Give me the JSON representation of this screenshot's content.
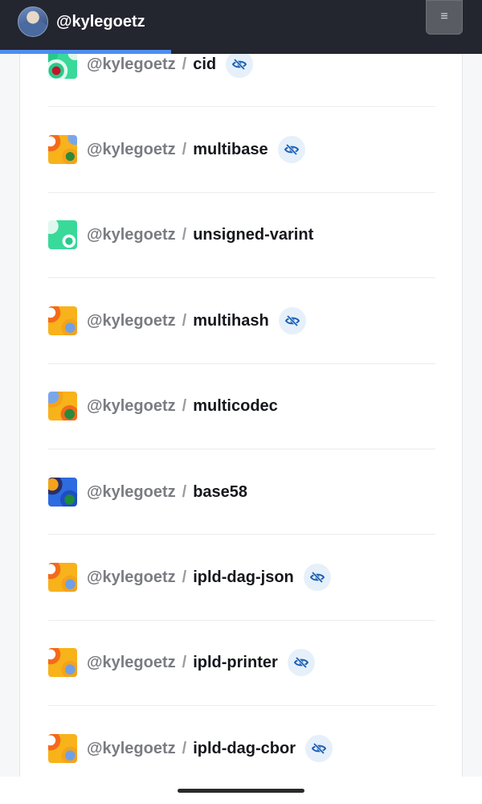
{
  "header": {
    "username": "@kylegoetz",
    "menu_icon": "hamburger-icon",
    "menu_glyph": "≡",
    "avatar_icon": "user-avatar"
  },
  "loading_progress": 0.355,
  "repos": [
    {
      "owner": "@kylegoetz",
      "separator": "/",
      "name": "cid",
      "private": true,
      "icon_style": "green"
    },
    {
      "owner": "@kylegoetz",
      "separator": "/",
      "name": "multibase",
      "private": true,
      "icon_style": "orange"
    },
    {
      "owner": "@kylegoetz",
      "separator": "/",
      "name": "unsigned-varint",
      "private": false,
      "icon_style": "green2"
    },
    {
      "owner": "@kylegoetz",
      "separator": "/",
      "name": "multihash",
      "private": true,
      "icon_style": "orange-blue"
    },
    {
      "owner": "@kylegoetz",
      "separator": "/",
      "name": "multicodec",
      "private": false,
      "icon_style": "orange-green"
    },
    {
      "owner": "@kylegoetz",
      "separator": "/",
      "name": "base58",
      "private": false,
      "icon_style": "blue"
    },
    {
      "owner": "@kylegoetz",
      "separator": "/",
      "name": "ipld-dag-json",
      "private": true,
      "icon_style": "orange-blue"
    },
    {
      "owner": "@kylegoetz",
      "separator": "/",
      "name": "ipld-printer",
      "private": true,
      "icon_style": "orange-blue"
    },
    {
      "owner": "@kylegoetz",
      "separator": "/",
      "name": "ipld-dag-cbor",
      "private": true,
      "icon_style": "orange-blue"
    }
  ],
  "colors": {
    "topbar": "#23252f",
    "progress": "#4f8cf0",
    "private_badge_bg": "#e6f0fb",
    "private_badge_icon": "#1a5fb4"
  },
  "private_badge_icon": "eye-slash-icon"
}
